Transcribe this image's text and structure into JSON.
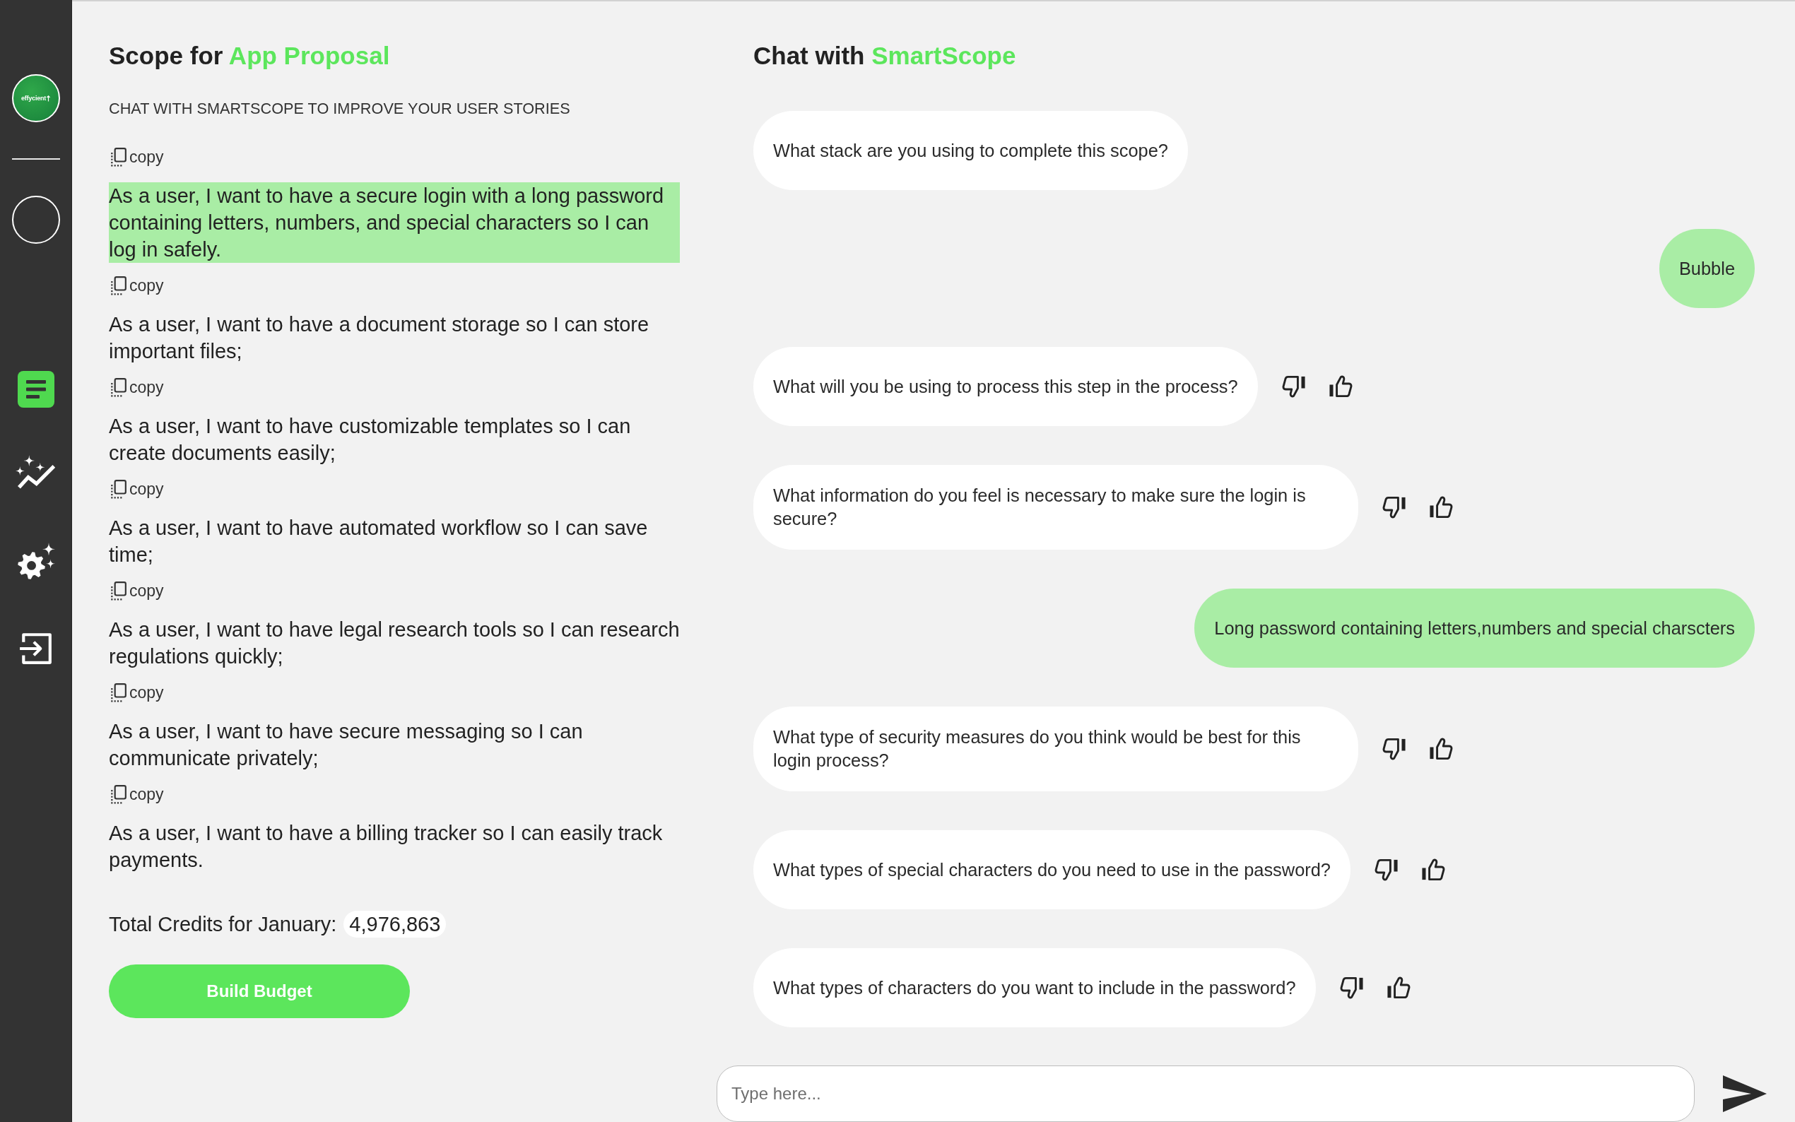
{
  "sidebar": {
    "logo": {
      "text": "effycient"
    },
    "items": [
      {
        "kind": "document",
        "selected": true
      },
      {
        "kind": "insights",
        "selected": false
      },
      {
        "kind": "settings",
        "selected": false
      },
      {
        "kind": "logout",
        "selected": false
      }
    ]
  },
  "scope": {
    "title": "Scope for",
    "title_accent": "App Proposal",
    "subtitle": "CHAT WITH SMARTSCOPE TO IMPROVE YOUR USER STORIES",
    "stories": [
      {
        "copy": "copy",
        "text": "As a user, I want to have a secure login with a long password containing letters, numbers, and special characters so I can log in safely.",
        "selected": true
      },
      {
        "copy": "copy",
        "text": "As a user, I want to have a document storage so I can store important files;",
        "selected": false
      },
      {
        "copy": "copy",
        "text": "As a user, I want to have customizable templates so I can create documents easily;",
        "selected": false
      },
      {
        "copy": "copy",
        "text": "As a user, I want to have automated workflow so I can save time;",
        "selected": false
      },
      {
        "copy": "copy",
        "text": "As a user, I want to have legal research tools so I can research regulations quickly;",
        "selected": false
      },
      {
        "copy": "copy",
        "text": "As a user, I want to have secure messaging so I can communicate privately;",
        "selected": false
      },
      {
        "copy": "copy",
        "text": "As a user, I want to have a billing tracker so I can easily track payments.",
        "selected": false
      }
    ],
    "credits": {
      "label": "Total Credits for January:",
      "value": "4,976,863"
    },
    "button": "Build Budget"
  },
  "chat": {
    "title": "Chat with",
    "title_accent": "SmartScope",
    "messages": [
      {
        "kind": "bot",
        "text": "What stack are you using to complete this scope?",
        "feedback": false
      },
      {
        "kind": "user",
        "text": "Bubble",
        "feedback": false
      },
      {
        "kind": "bot",
        "text": "What will you be using to process this step in the process?",
        "feedback": true
      },
      {
        "kind": "bot",
        "text": "What information do you feel is necessary to make sure the login is secure?",
        "feedback": true
      },
      {
        "kind": "user",
        "text": "Long password containing letters,numbers and special charscters",
        "feedback": false
      },
      {
        "kind": "bot",
        "text": "What type of security measures do you think would be best for this login process?",
        "feedback": true
      },
      {
        "kind": "bot",
        "text": "What types of special characters do you need to use in the password?",
        "feedback": true
      },
      {
        "kind": "bot",
        "text": "What types of characters do you want to include in the password?",
        "feedback": true
      }
    ],
    "input": {
      "placeholder": "Type here..."
    }
  }
}
